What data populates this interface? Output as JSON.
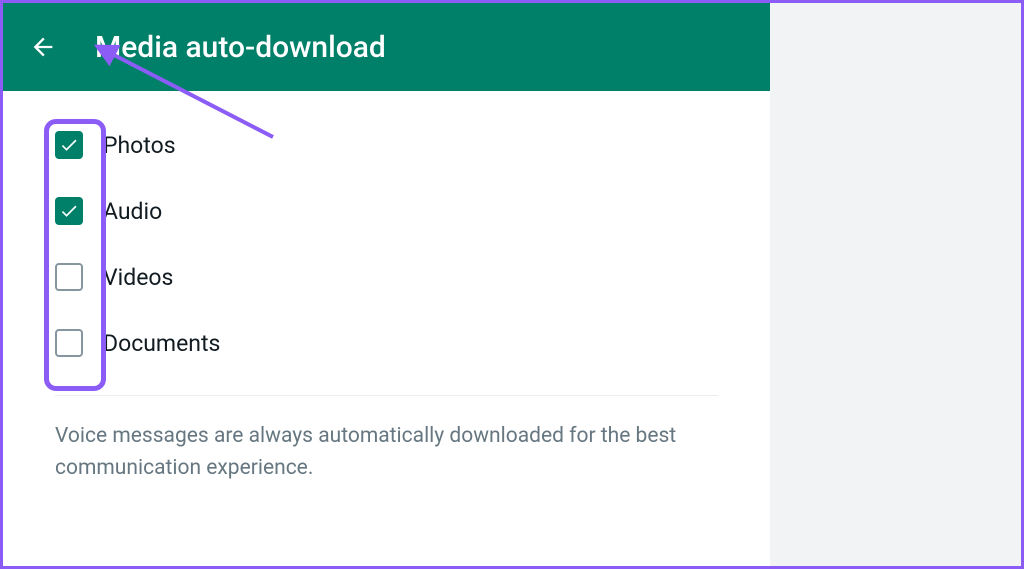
{
  "header": {
    "title": "Media auto-download"
  },
  "options": [
    {
      "label": "Photos",
      "checked": true
    },
    {
      "label": "Audio",
      "checked": true
    },
    {
      "label": "Videos",
      "checked": false
    },
    {
      "label": "Documents",
      "checked": false
    }
  ],
  "footer_text": "Voice messages are always automatically downloaded for the best communication experience."
}
